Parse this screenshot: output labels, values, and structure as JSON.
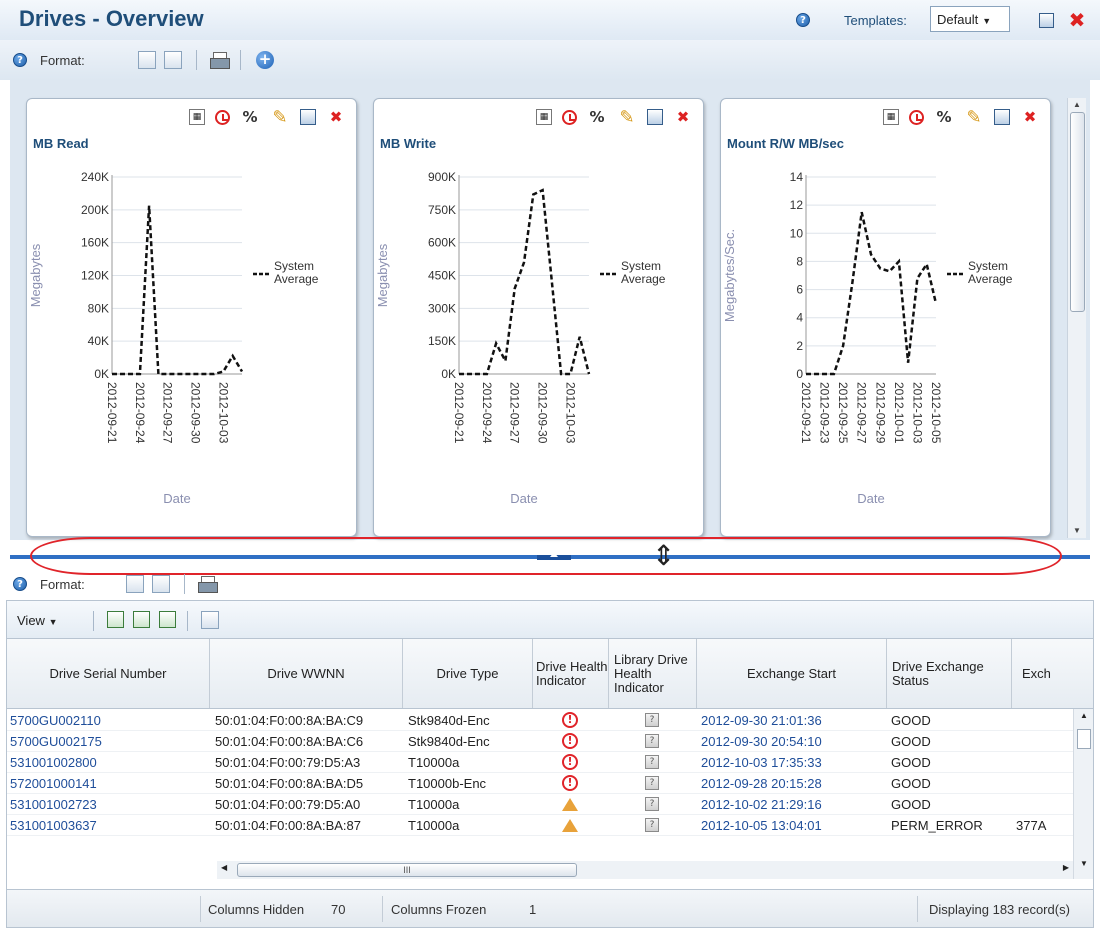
{
  "page": {
    "title": "Drives - Overview"
  },
  "header": {
    "templates_label": "Templates:",
    "template_value": "Default"
  },
  "toolbar": {
    "help_glyph": "?",
    "format_label": "Format:"
  },
  "charts": [
    {
      "title": "MB Read",
      "legend": "System Average",
      "ylabel": "Megabytes",
      "xlabel": "Date",
      "yticks": [
        "240K",
        "200K",
        "160K",
        "120K",
        "80K",
        "40K",
        "0K"
      ],
      "xticks": [
        "2012-09-21",
        "2012-09-24",
        "2012-09-27",
        "2012-09-30",
        "2012-10-03"
      ]
    },
    {
      "title": "MB Write",
      "legend": "System Average",
      "ylabel": "Megabytes",
      "xlabel": "Date",
      "yticks": [
        "900K",
        "750K",
        "600K",
        "450K",
        "300K",
        "150K",
        "0K"
      ],
      "xticks": [
        "2012-09-21",
        "2012-09-24",
        "2012-09-27",
        "2012-09-30",
        "2012-10-03"
      ]
    },
    {
      "title": "Mount R/W MB/sec",
      "legend": "System Average",
      "ylabel": "Megabytes/Sec.",
      "xlabel": "Date",
      "yticks": [
        "14",
        "12",
        "10",
        "8",
        "6",
        "4",
        "2",
        "0"
      ],
      "xticks": [
        "2012-09-21",
        "2012-09-23",
        "2012-09-25",
        "2012-09-27",
        "2012-09-29",
        "2012-10-01",
        "2012-10-03",
        "2012-10-05"
      ]
    }
  ],
  "chart_data": [
    {
      "type": "line",
      "title": "MB Read",
      "xlabel": "Date",
      "ylabel": "Megabytes",
      "ylim": [
        0,
        240000
      ],
      "x": [
        "2012-09-21",
        "2012-09-22",
        "2012-09-23",
        "2012-09-24",
        "2012-09-25",
        "2012-09-26",
        "2012-09-27",
        "2012-09-28",
        "2012-09-29",
        "2012-09-30",
        "2012-10-01",
        "2012-10-02",
        "2012-10-03",
        "2012-10-04",
        "2012-10-05"
      ],
      "series": [
        {
          "name": "System Average",
          "values": [
            0,
            0,
            0,
            0,
            205000,
            0,
            0,
            0,
            0,
            0,
            0,
            0,
            3000,
            22000,
            3000
          ]
        }
      ]
    },
    {
      "type": "line",
      "title": "MB Write",
      "xlabel": "Date",
      "ylabel": "Megabytes",
      "ylim": [
        0,
        900000
      ],
      "x": [
        "2012-09-21",
        "2012-09-22",
        "2012-09-23",
        "2012-09-24",
        "2012-09-25",
        "2012-09-26",
        "2012-09-27",
        "2012-09-28",
        "2012-09-29",
        "2012-09-30",
        "2012-10-01",
        "2012-10-02",
        "2012-10-03",
        "2012-10-04",
        "2012-10-05"
      ],
      "series": [
        {
          "name": "System Average",
          "values": [
            0,
            0,
            0,
            0,
            140000,
            60000,
            390000,
            510000,
            820000,
            840000,
            420000,
            0,
            0,
            170000,
            0
          ]
        }
      ]
    },
    {
      "type": "line",
      "title": "Mount R/W MB/sec",
      "xlabel": "Date",
      "ylabel": "Megabytes/Sec.",
      "ylim": [
        0,
        14
      ],
      "x": [
        "2012-09-21",
        "2012-09-22",
        "2012-09-23",
        "2012-09-24",
        "2012-09-25",
        "2012-09-26",
        "2012-09-27",
        "2012-09-28",
        "2012-09-29",
        "2012-09-30",
        "2012-10-01",
        "2012-10-02",
        "2012-10-03",
        "2012-10-04",
        "2012-10-05"
      ],
      "series": [
        {
          "name": "System Average",
          "values": [
            0,
            0,
            0,
            0,
            2,
            6.5,
            11.5,
            8.5,
            7.5,
            7.3,
            8,
            0.8,
            6.8,
            7.8,
            5
          ]
        }
      ]
    }
  ],
  "table_toolbar": {
    "view_label": "View"
  },
  "table": {
    "columns": [
      "Drive Serial Number",
      "Drive WWNN",
      "Drive Type",
      "Drive Health Indicator",
      "Library Drive Health Indicator",
      "Exchange Start",
      "Drive Exchange Status",
      "Exch"
    ],
    "rows": [
      {
        "serial": "5700GU002110",
        "wwnn": "50:01:04:F0:00:8A:BA:C9",
        "type": "Stk9840d-Enc",
        "health": "error",
        "lib": "unknown",
        "start": "2012-09-30 21:01:36",
        "status": "GOOD",
        "exch": ""
      },
      {
        "serial": "5700GU002175",
        "wwnn": "50:01:04:F0:00:8A:BA:C6",
        "type": "Stk9840d-Enc",
        "health": "error",
        "lib": "unknown",
        "start": "2012-09-30 20:54:10",
        "status": "GOOD",
        "exch": ""
      },
      {
        "serial": "531001002800",
        "wwnn": "50:01:04:F0:00:79:D5:A3",
        "type": "T10000a",
        "health": "error",
        "lib": "unknown",
        "start": "2012-10-03 17:35:33",
        "status": "GOOD",
        "exch": ""
      },
      {
        "serial": "572001000141",
        "wwnn": "50:01:04:F0:00:8A:BA:D5",
        "type": "T10000b-Enc",
        "health": "error",
        "lib": "unknown",
        "start": "2012-09-28 20:15:28",
        "status": "GOOD",
        "exch": ""
      },
      {
        "serial": "531001002723",
        "wwnn": "50:01:04:F0:00:79:D5:A0",
        "type": "T10000a",
        "health": "warning",
        "lib": "unknown",
        "start": "2012-10-02 21:29:16",
        "status": "GOOD",
        "exch": ""
      },
      {
        "serial": "531001003637",
        "wwnn": "50:01:04:F0:00:8A:BA:87",
        "type": "T10000a",
        "health": "warning",
        "lib": "unknown",
        "start": "2012-10-05 13:04:01",
        "status": "PERM_ERROR",
        "exch": "377A"
      }
    ]
  },
  "status": {
    "columns_hidden_label": "Columns Hidden",
    "columns_hidden": "70",
    "columns_frozen_label": "Columns Frozen",
    "columns_frozen": "1",
    "displaying": "Displaying 183 record(s)"
  },
  "scroll": {
    "hthumb_grip": "III"
  },
  "colors": {
    "accent": "#1f4e79",
    "line": "#111111",
    "splitter": "#2f6fc4",
    "highlight": "#e0242a"
  }
}
